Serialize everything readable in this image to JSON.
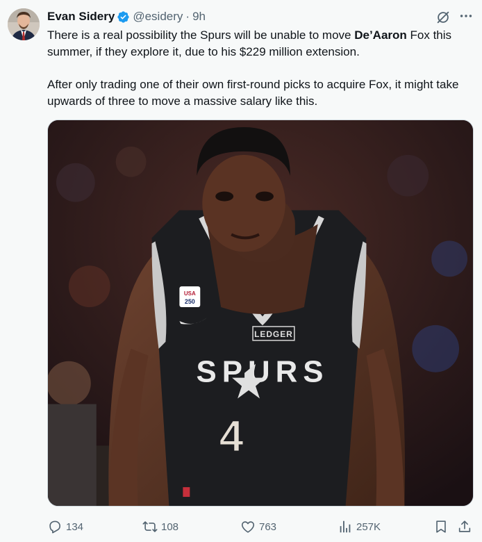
{
  "tweet": {
    "author_name": "Evan Sidery",
    "handle": "@esidery",
    "separator": "·",
    "time": "9h",
    "text_p1_before": "There is a real possibility the Spurs will be unable to move ",
    "text_p1_bold": "De’Aaron",
    "text_p1_after": " Fox this summer, if they explore it, due to his $229 million extension.",
    "text_p2": "After only trading one of their own first-round picks to acquire Fox, it might take upwards of three to move a massive salary like this."
  },
  "media": {
    "jersey_team": "SPURS",
    "jersey_number": "4",
    "sponsor": "LEDGER",
    "patch_lines": [
      "USA",
      "250"
    ]
  },
  "stats": {
    "replies": "134",
    "retweets": "108",
    "likes": "763",
    "views": "257K"
  },
  "colors": {
    "accent": "#1d9bf0",
    "muted": "#536471",
    "background": "#f7f9f9"
  },
  "icons": [
    "verified-badge-icon",
    "grok-icon",
    "more-icon",
    "reply-icon",
    "retweet-icon",
    "like-icon",
    "views-icon",
    "bookmark-icon",
    "share-icon"
  ]
}
